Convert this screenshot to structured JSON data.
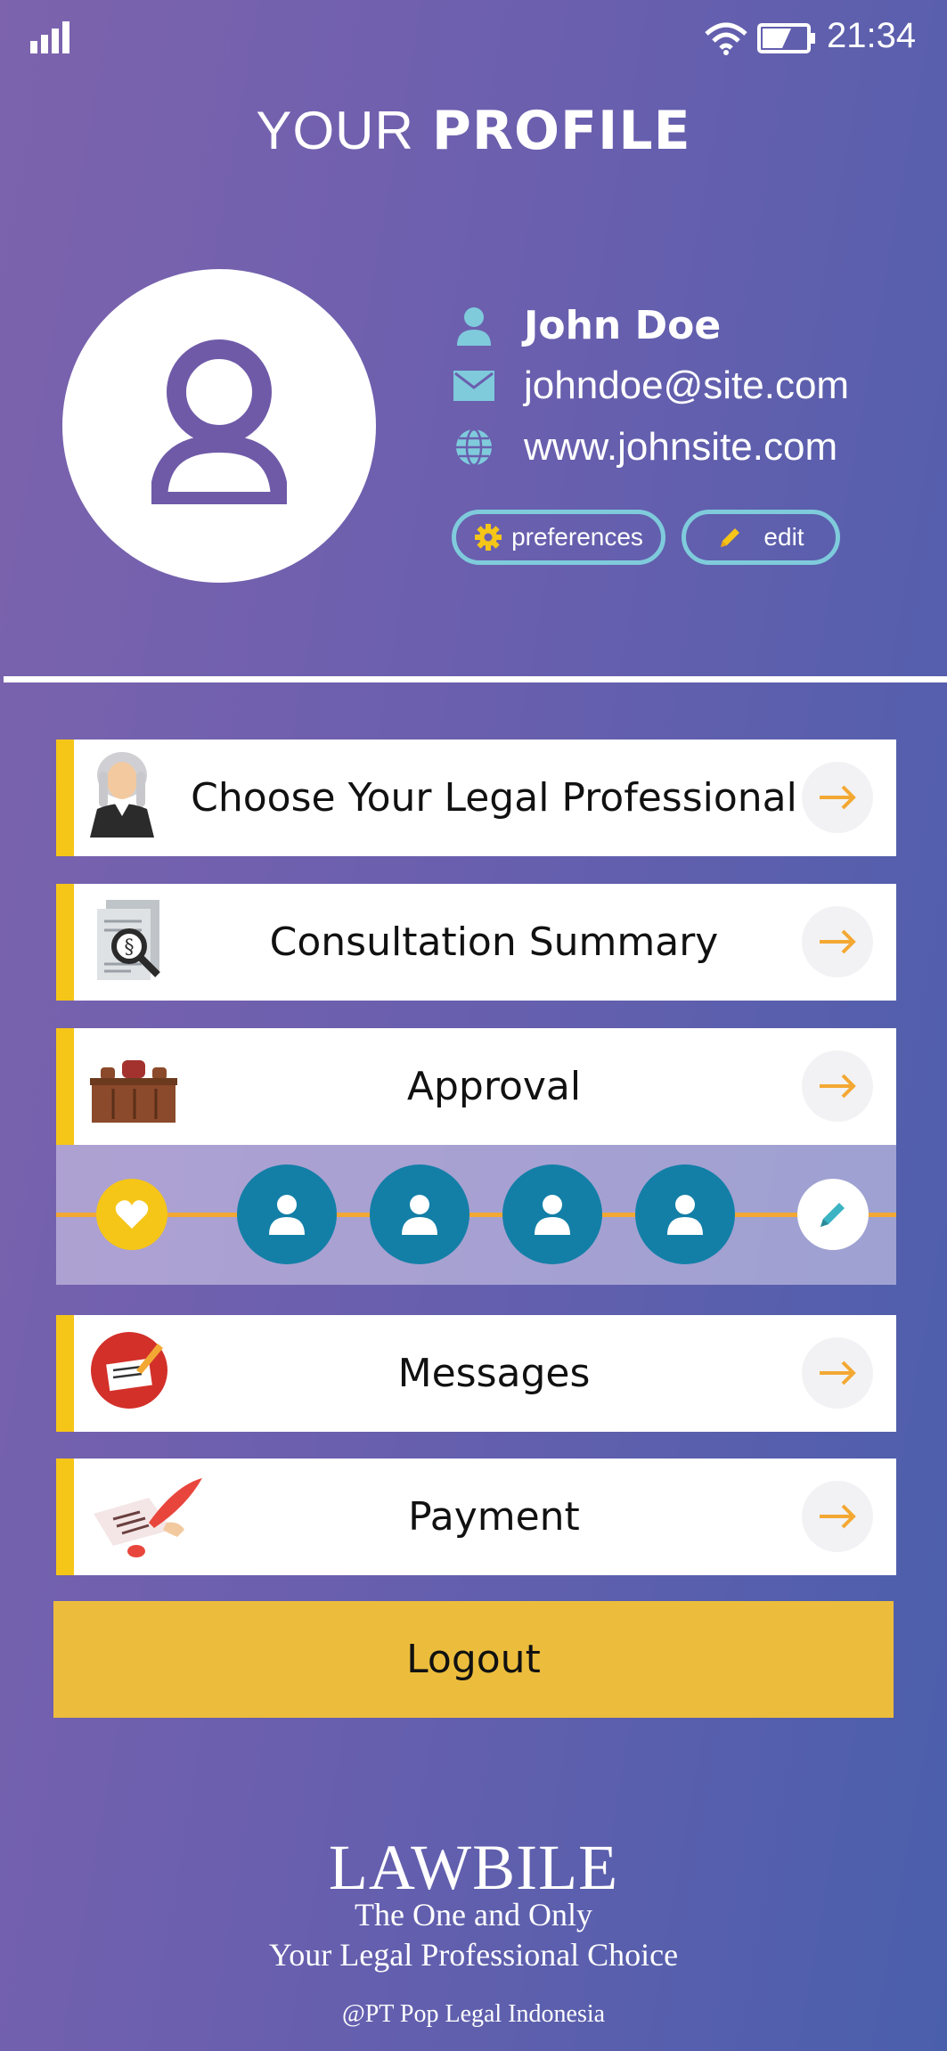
{
  "status_bar": {
    "time": "21:34"
  },
  "header": {
    "title_light": "YOUR",
    "title_bold": "PROFILE"
  },
  "profile": {
    "name": "John Doe",
    "email": "johndoe@site.com",
    "website": "www.johnsite.com",
    "preferences_label": "preferences",
    "edit_label": "edit"
  },
  "menu": {
    "items": [
      {
        "label": "Choose Your Legal Professional",
        "icon": "judge-icon"
      },
      {
        "label": "Consultation Summary",
        "icon": "document-search-icon"
      },
      {
        "label": "Approval",
        "icon": "courtroom-bench-icon"
      },
      {
        "label": "Messages",
        "icon": "signed-document-icon"
      },
      {
        "label": "Payment",
        "icon": "quill-signature-icon"
      }
    ]
  },
  "approval_track": {
    "nodes": [
      "heart-icon",
      "user-icon",
      "user-icon",
      "user-icon",
      "user-icon",
      "pencil-icon"
    ]
  },
  "logout": {
    "label": "Logout"
  },
  "footer": {
    "brand": "LAWBILE",
    "tagline_1": "The One and Only",
    "tagline_2": "Your Legal Professional Choice",
    "copyright": "@PT Pop Legal Indonesia"
  },
  "colors": {
    "accent_yellow": "#f5c518",
    "arrow_orange": "#f3a833",
    "teal_outline": "#7fcbdc",
    "user_node_blue": "#137fa7",
    "avatar_purple": "#6f5aa8"
  }
}
